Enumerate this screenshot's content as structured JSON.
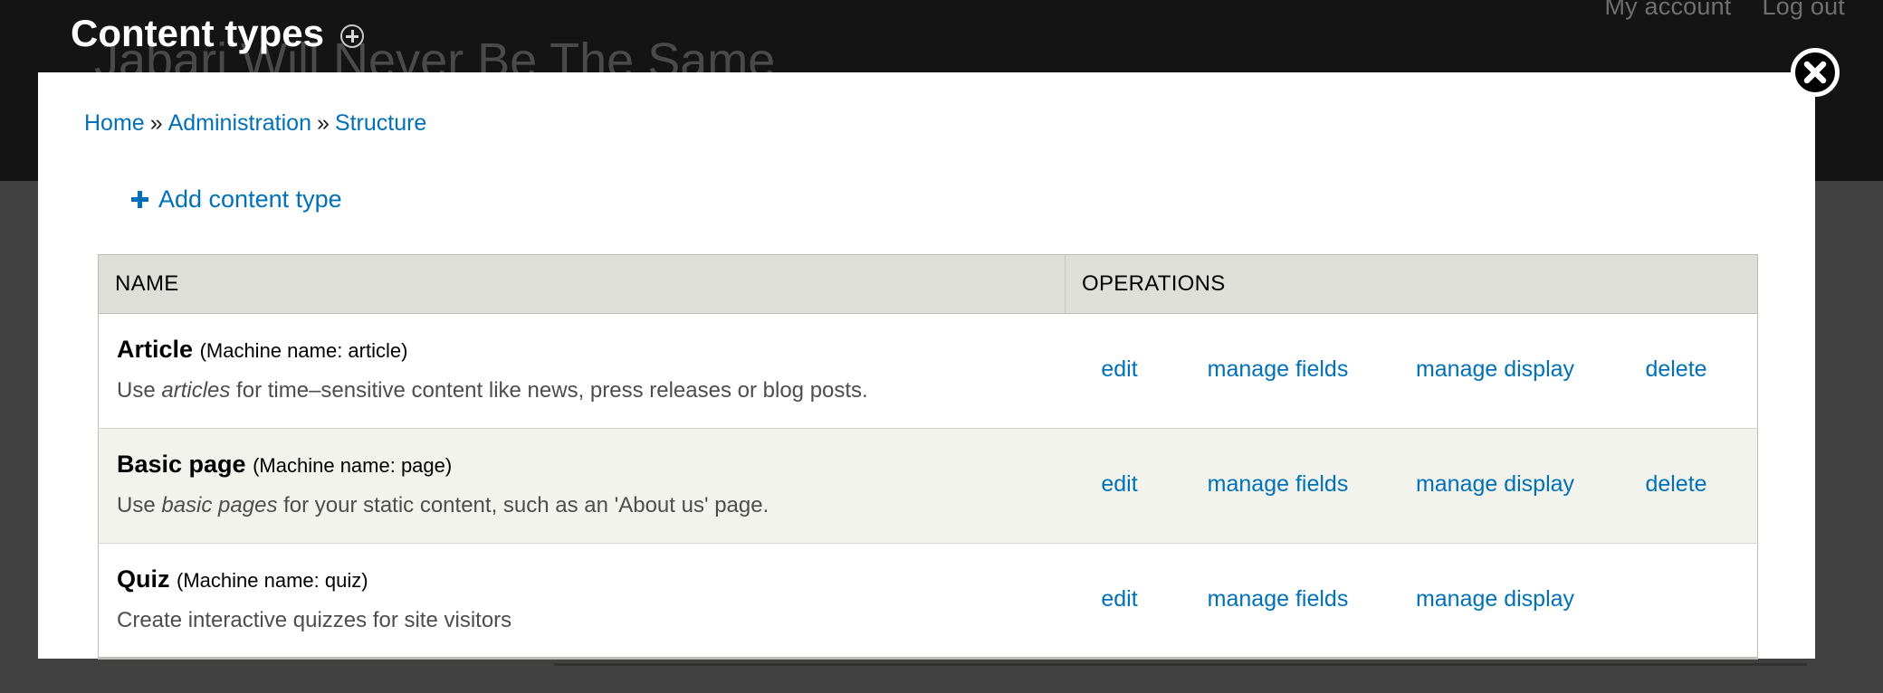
{
  "site": {
    "page_title": "Content types",
    "contextual_icon": "circle-plus-icon",
    "background_headline": "Jabari Will Never Be The Same",
    "user_links": [
      {
        "label": "My account"
      },
      {
        "label": "Log out"
      }
    ]
  },
  "modal": {
    "close_icon": "close-icon",
    "breadcrumb": {
      "separator": "»",
      "items": [
        {
          "label": "Home"
        },
        {
          "label": "Administration"
        },
        {
          "label": "Structure"
        }
      ]
    },
    "add_link": {
      "icon": "plus-icon",
      "label": "Add content type"
    },
    "table": {
      "columns": [
        {
          "key": "name",
          "label": "NAME"
        },
        {
          "key": "operations",
          "label": "OPERATIONS"
        }
      ],
      "rows": [
        {
          "name": "Article",
          "machine_name": "(Machine name: article)",
          "description_before": "Use ",
          "description_em": "articles",
          "description_after": " for time–sensitive content like news, press releases or blog posts.",
          "operations": {
            "edit": "edit",
            "manage_fields": "manage fields",
            "manage_display": "manage display",
            "delete": "delete"
          }
        },
        {
          "name": "Basic page",
          "machine_name": "(Machine name: page)",
          "description_before": "Use ",
          "description_em": "basic pages",
          "description_after": " for your static content, such as an 'About us' page.",
          "operations": {
            "edit": "edit",
            "manage_fields": "manage fields",
            "manage_display": "manage display",
            "delete": "delete"
          }
        },
        {
          "name": "Quiz",
          "machine_name": "(Machine name: quiz)",
          "description_before": "Create interactive quizzes for site visitors",
          "description_em": "",
          "description_after": "",
          "operations": {
            "edit": "edit",
            "manage_fields": "manage fields",
            "manage_display": "manage display",
            "delete": ""
          }
        }
      ]
    }
  },
  "colors": {
    "link": "#0071b8",
    "topbar": "#141414",
    "backdrop": "#414141",
    "table_header": "#dfdfd9",
    "row_alt": "#f3f3ee"
  }
}
